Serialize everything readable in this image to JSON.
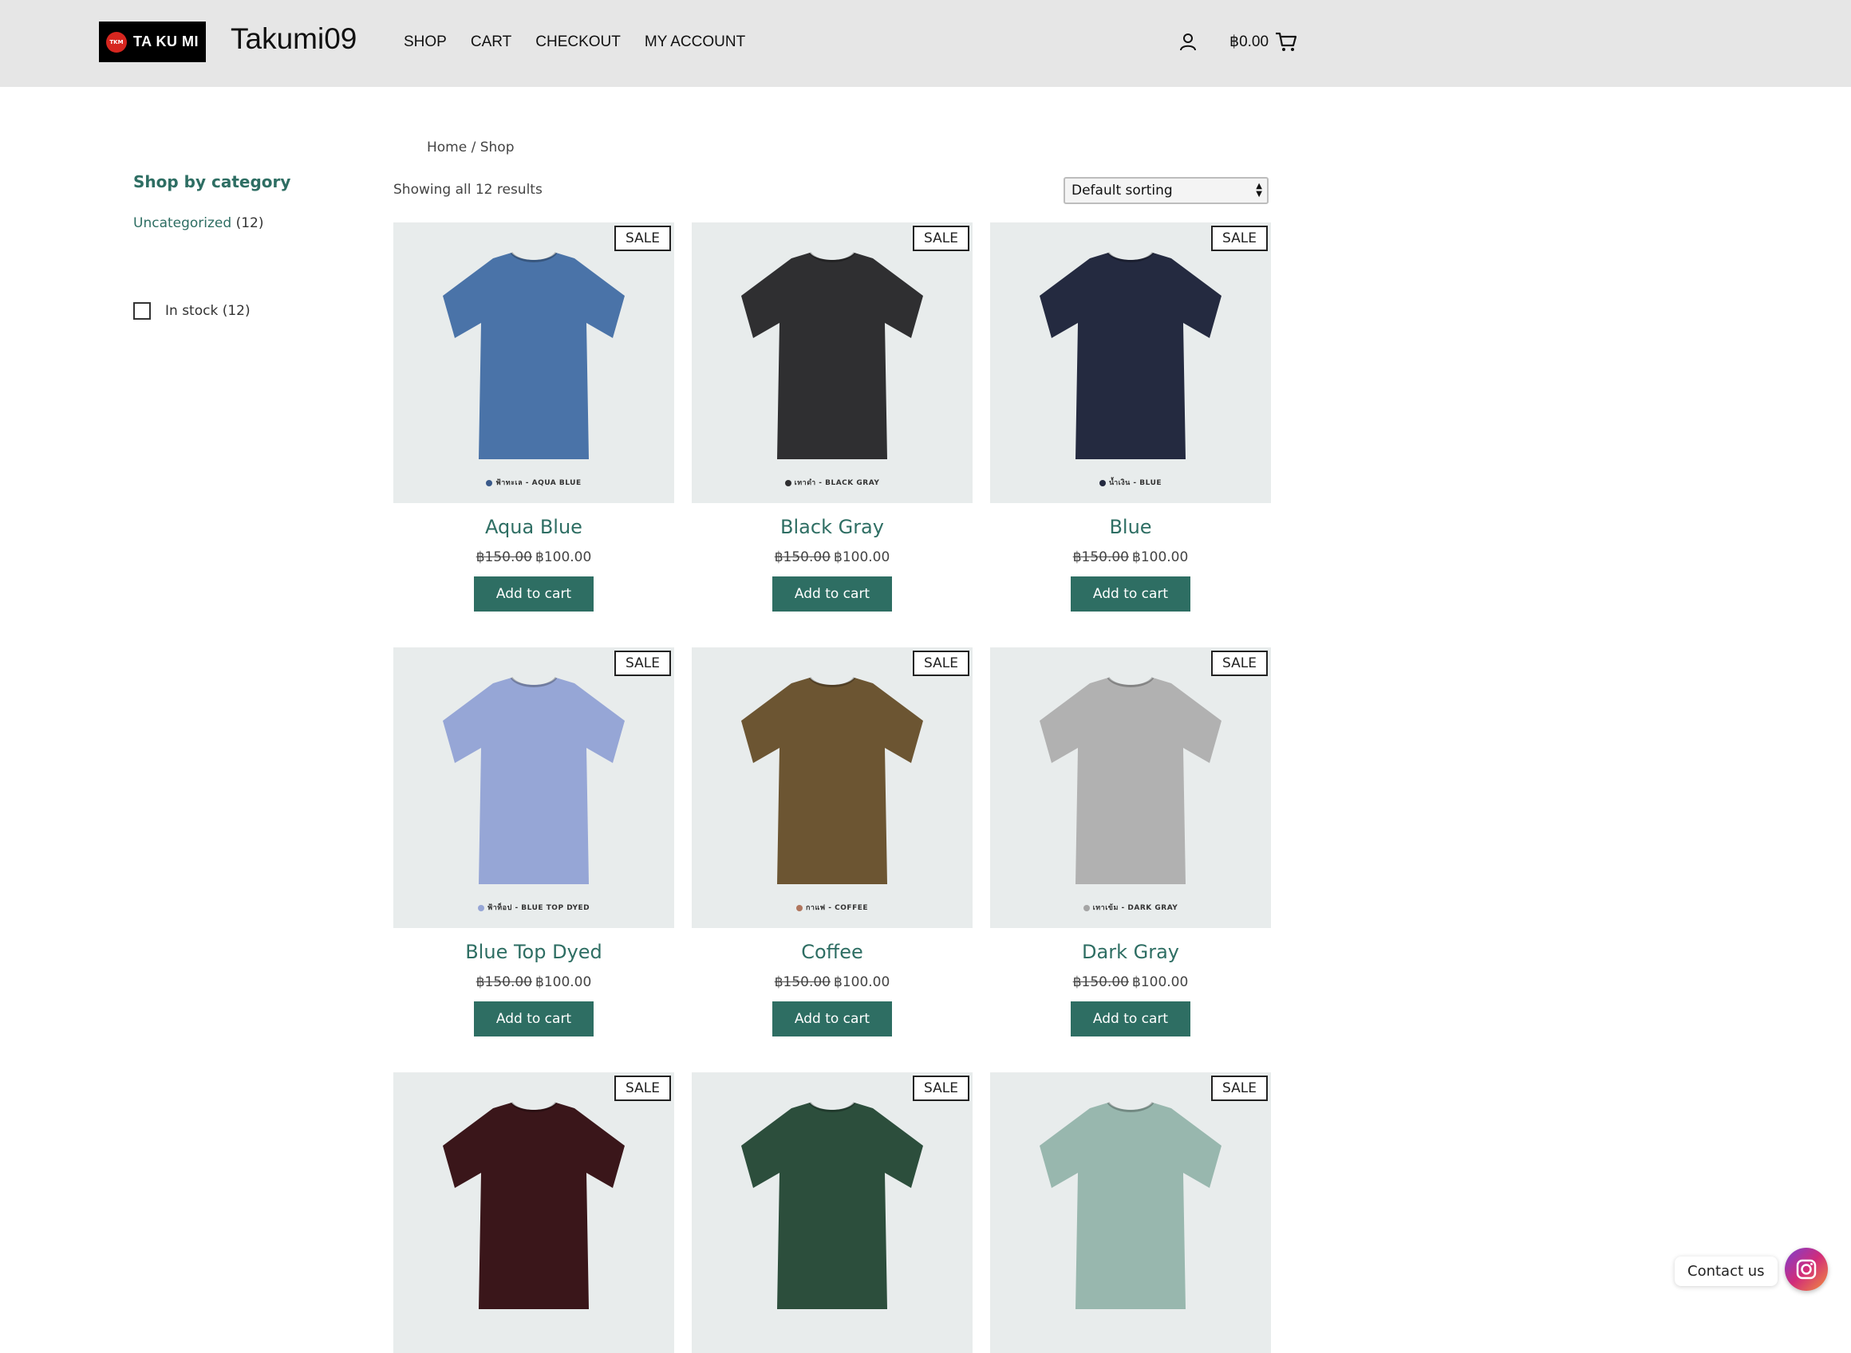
{
  "header": {
    "logo_text": "TA KU MI",
    "logo_mark": "TKM",
    "site_title": "Takumi09",
    "nav": [
      "SHOP",
      "CART",
      "CHECKOUT",
      "MY ACCOUNT"
    ],
    "cart_total": "฿0.00"
  },
  "sidebar": {
    "title": "Shop by category",
    "category_label": "Uncategorized",
    "category_count": "(12)",
    "stock_label": "In stock (12)"
  },
  "main": {
    "breadcrumb": "Home / Shop",
    "result_count": "Showing all 12 results",
    "sort_selected": "Default sorting",
    "badge": "SALE",
    "add_to_cart_label": "Add to cart"
  },
  "products": [
    {
      "name": "Aqua Blue",
      "old_price": "฿150.00",
      "price": "฿100.00",
      "caption": "ฟ้าทะเล - AQUA BLUE",
      "shirt_color": "#4a73a8",
      "dot_color": "#3a5a8a"
    },
    {
      "name": "Black Gray",
      "old_price": "฿150.00",
      "price": "฿100.00",
      "caption": "เทาดำ - BLACK GRAY",
      "shirt_color": "#2f2f31",
      "dot_color": "#2f2f31"
    },
    {
      "name": "Blue",
      "old_price": "฿150.00",
      "price": "฿100.00",
      "caption": "น้ำเงิน - BLUE",
      "shirt_color": "#242a40",
      "dot_color": "#242a40"
    },
    {
      "name": "Blue Top Dyed",
      "old_price": "฿150.00",
      "price": "฿100.00",
      "caption": "ฟ้าท็อป - BLUE TOP DYED",
      "shirt_color": "#96a6d6",
      "dot_color": "#96a6d6"
    },
    {
      "name": "Coffee",
      "old_price": "฿150.00",
      "price": "฿100.00",
      "caption": "กาแฟ - COFFEE",
      "shirt_color": "#6c5532",
      "dot_color": "#b0765e"
    },
    {
      "name": "Dark Gray",
      "old_price": "฿150.00",
      "price": "฿100.00",
      "caption": "เทาเข้ม - DARK GRAY",
      "shirt_color": "#b1b1b1",
      "dot_color": "#a5a5a5"
    },
    {
      "name": "",
      "old_price": "",
      "price": "",
      "caption": "",
      "shirt_color": "#3a161a",
      "dot_color": "#3a161a"
    },
    {
      "name": "",
      "old_price": "",
      "price": "",
      "caption": "",
      "shirt_color": "#2c4e3c",
      "dot_color": "#2c4e3c"
    },
    {
      "name": "",
      "old_price": "",
      "price": "",
      "caption": "",
      "shirt_color": "#98b7ae",
      "dot_color": "#98b7ae"
    }
  ],
  "contact": {
    "label": "Contact us"
  },
  "colors": {
    "accent": "#2e6e63",
    "header_bg": "#e6e6e6",
    "card_bg": "#e8ecec"
  }
}
